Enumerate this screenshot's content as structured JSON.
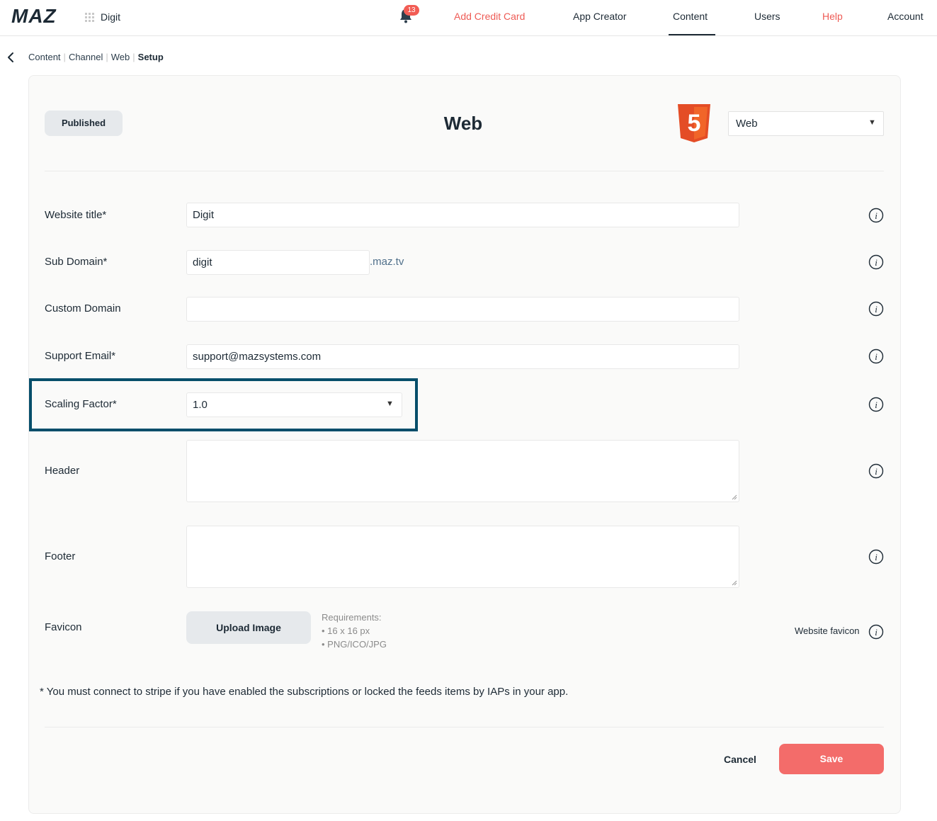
{
  "header": {
    "logo_text": "MAZ",
    "app_name": "Digit",
    "notification_count": "13",
    "nav": [
      {
        "label": "Add Credit Card",
        "accent": true
      },
      {
        "label": "App Creator",
        "accent": false
      },
      {
        "label": "Content",
        "accent": false,
        "active": true
      },
      {
        "label": "Users",
        "accent": false
      },
      {
        "label": "Help",
        "accent": true
      },
      {
        "label": "Account",
        "accent": false
      }
    ]
  },
  "breadcrumb": [
    "Content",
    "Channel",
    "Web",
    "Setup"
  ],
  "page": {
    "status": "Published",
    "title": "Web",
    "channel_select": "Web",
    "platform_logo_text": "5"
  },
  "form": {
    "website_title": {
      "label": "Website title*",
      "value": "Digit"
    },
    "sub_domain": {
      "label": "Sub Domain*",
      "value": "digit",
      "suffix": ".maz.tv"
    },
    "custom_domain": {
      "label": "Custom Domain",
      "value": ""
    },
    "support_email": {
      "label": "Support Email*",
      "value": "support@mazsystems.com"
    },
    "scaling_factor": {
      "label": "Scaling Factor*",
      "value": "1.0"
    },
    "header": {
      "label": "Header",
      "value": ""
    },
    "footer": {
      "label": "Footer",
      "value": ""
    },
    "favicon": {
      "label": "Favicon",
      "button": "Upload Image",
      "requirements_title": "Requirements:",
      "requirements": [
        "• 16 x 16 px",
        "• PNG/ICO/JPG"
      ],
      "hint": "Website favicon"
    }
  },
  "note": "* You must connect to stripe if you have enabled the subscriptions or locked the feeds items by IAPs in your app.",
  "actions": {
    "cancel": "Cancel",
    "save": "Save"
  },
  "colors": {
    "accent": "#ee5b55",
    "save": "#f36c6a",
    "highlight": "#064e6a",
    "text": "#1d2a35"
  }
}
